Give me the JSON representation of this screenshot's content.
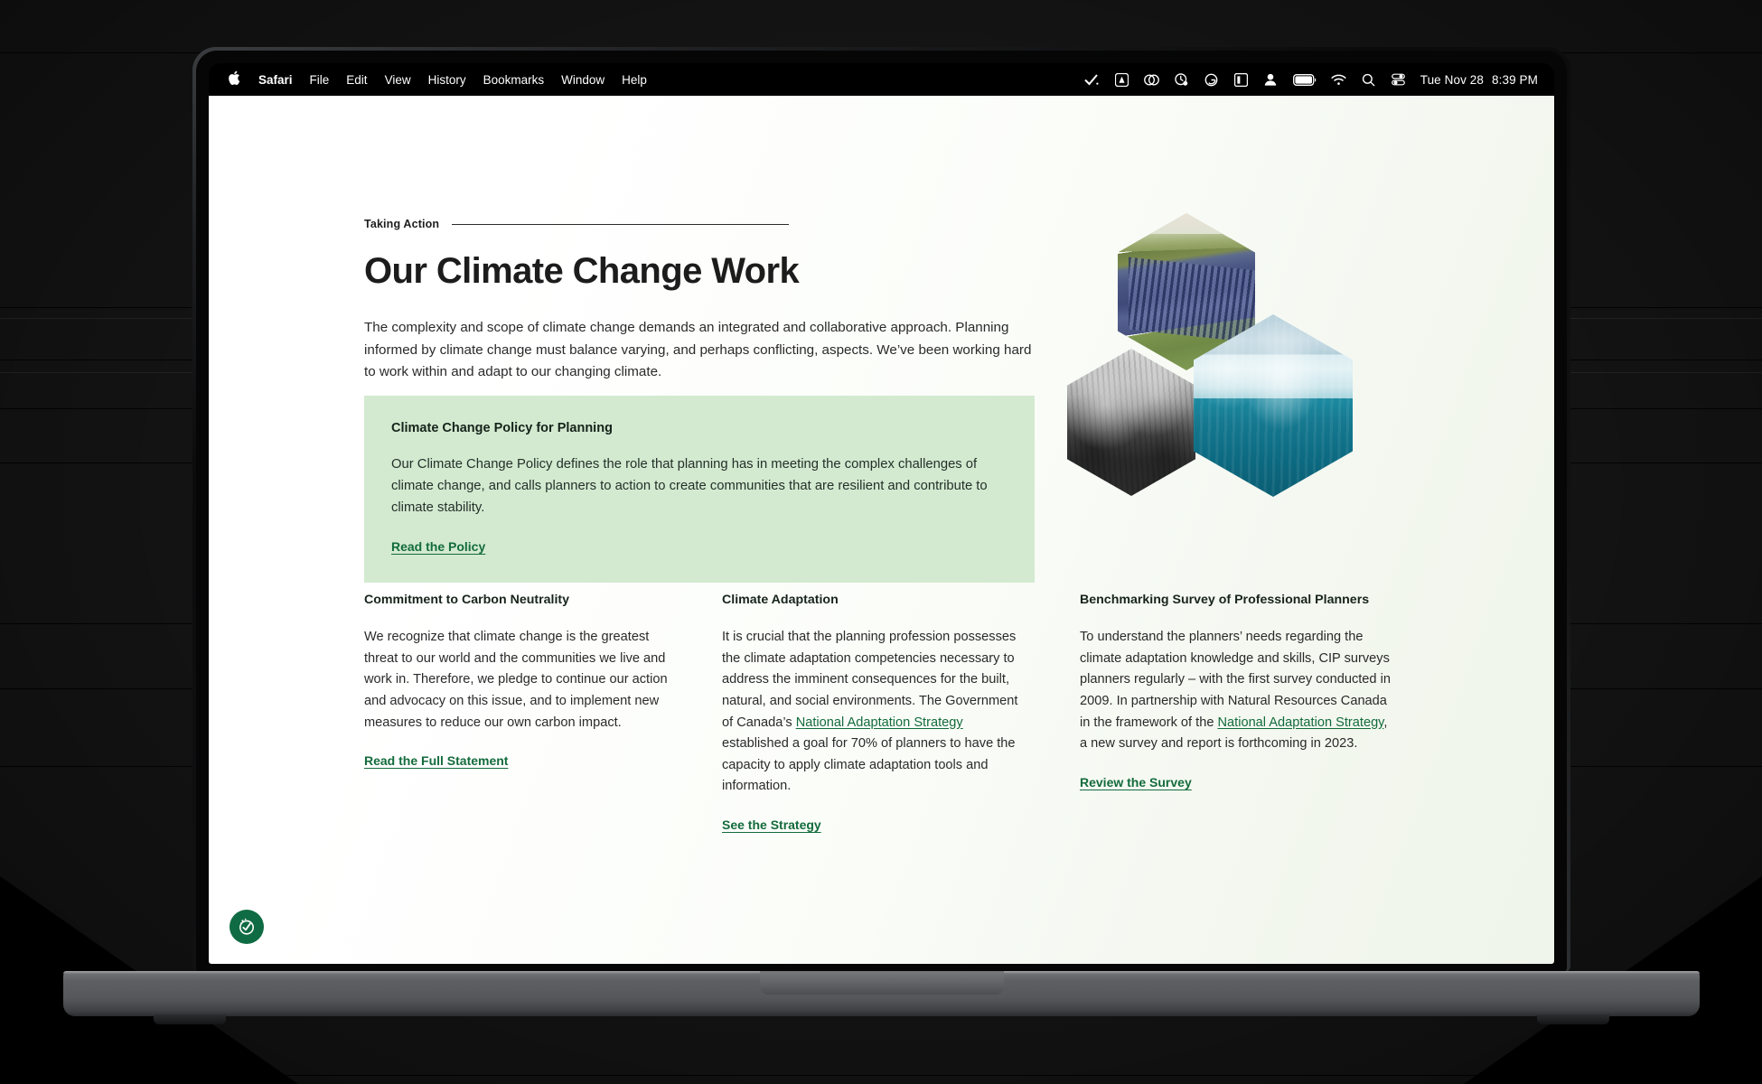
{
  "menubar": {
    "apple_glyph": "",
    "items": [
      {
        "label": "Safari",
        "bold": true
      },
      {
        "label": "File",
        "bold": false
      },
      {
        "label": "Edit",
        "bold": false
      },
      {
        "label": "View",
        "bold": false
      },
      {
        "label": "History",
        "bold": false
      },
      {
        "label": "Bookmarks",
        "bold": false
      },
      {
        "label": "Window",
        "bold": false
      },
      {
        "label": "Help",
        "bold": false
      }
    ],
    "status_icons": [
      "checkmark-icon",
      "adobe-icon",
      "creative-cloud-icon",
      "dropbox-sync-icon",
      "grammarly-icon",
      "control-center-icon",
      "user-account-icon",
      "battery-icon",
      "wifi-icon",
      "spotlight-search-icon",
      "menu-toggles-icon"
    ],
    "date": "Tue Nov 28",
    "time": "8:39 PM"
  },
  "page": {
    "eyebrow": "Taking Action",
    "headline": "Our Climate Change Work",
    "intro": "The complexity and scope of climate change demands an integrated and collaborative approach. Planning informed by climate change must balance varying, and perhaps conflicting, aspects. We’ve been working hard to work within and adapt to our changing climate.",
    "callout": {
      "title": "Climate Change Policy for Planning",
      "body": "Our Climate Change Policy defines the role that planning has in meeting the complex challenges of climate change, and calls planners to action to create communities that are resilient and contribute to climate stability.",
      "link": "Read the Policy"
    },
    "hexagons": [
      {
        "name": "solar-farm-hexagon-image"
      },
      {
        "name": "smoky-forest-hexagon-image"
      },
      {
        "name": "iceberg-hexagon-image"
      }
    ],
    "columns": [
      {
        "title": "Commitment to Carbon Neutrality",
        "body": "We recognize that climate change is the greatest threat to our world and the communities we live and work in. Therefore, we pledge to continue our action and advocacy on this issue, and to implement new measures to reduce our own carbon impact.",
        "link": "Read the Full Statement",
        "body_before_link": "",
        "inline_link": "",
        "body_after_link": ""
      },
      {
        "title": "Climate Adaptation",
        "body": "",
        "body_before_link": "It is crucial that the planning profession possesses the climate adaptation competencies necessary to address the imminent consequences for the built, natural, and social environments. The Government of Canada’s ",
        "inline_link": "National Adaptation Strategy",
        "body_after_link": " established a goal for 70% of planners to have the capacity to apply climate adaptation tools and information.",
        "link": "See the Strategy"
      },
      {
        "title": "Benchmarking Survey of Professional Planners",
        "body": "",
        "body_before_link": "To understand the planners’ needs regarding the climate adaptation knowledge and skills, CIP surveys planners regularly – with the first survey conducted in 2009. In partnership with Natural Resources Canada in the framework of the ",
        "inline_link": "National Adaptation Strategy",
        "body_after_link": ", a new survey and report is forthcoming in 2023.",
        "link": "Review the Survey"
      }
    ],
    "accessibility_badge": "accessibility-widget"
  },
  "colors": {
    "callout_bg": "#d3ead0",
    "link_green": "#136b3c",
    "badge_green": "#0f6b43",
    "text": "#2a2a2a"
  }
}
